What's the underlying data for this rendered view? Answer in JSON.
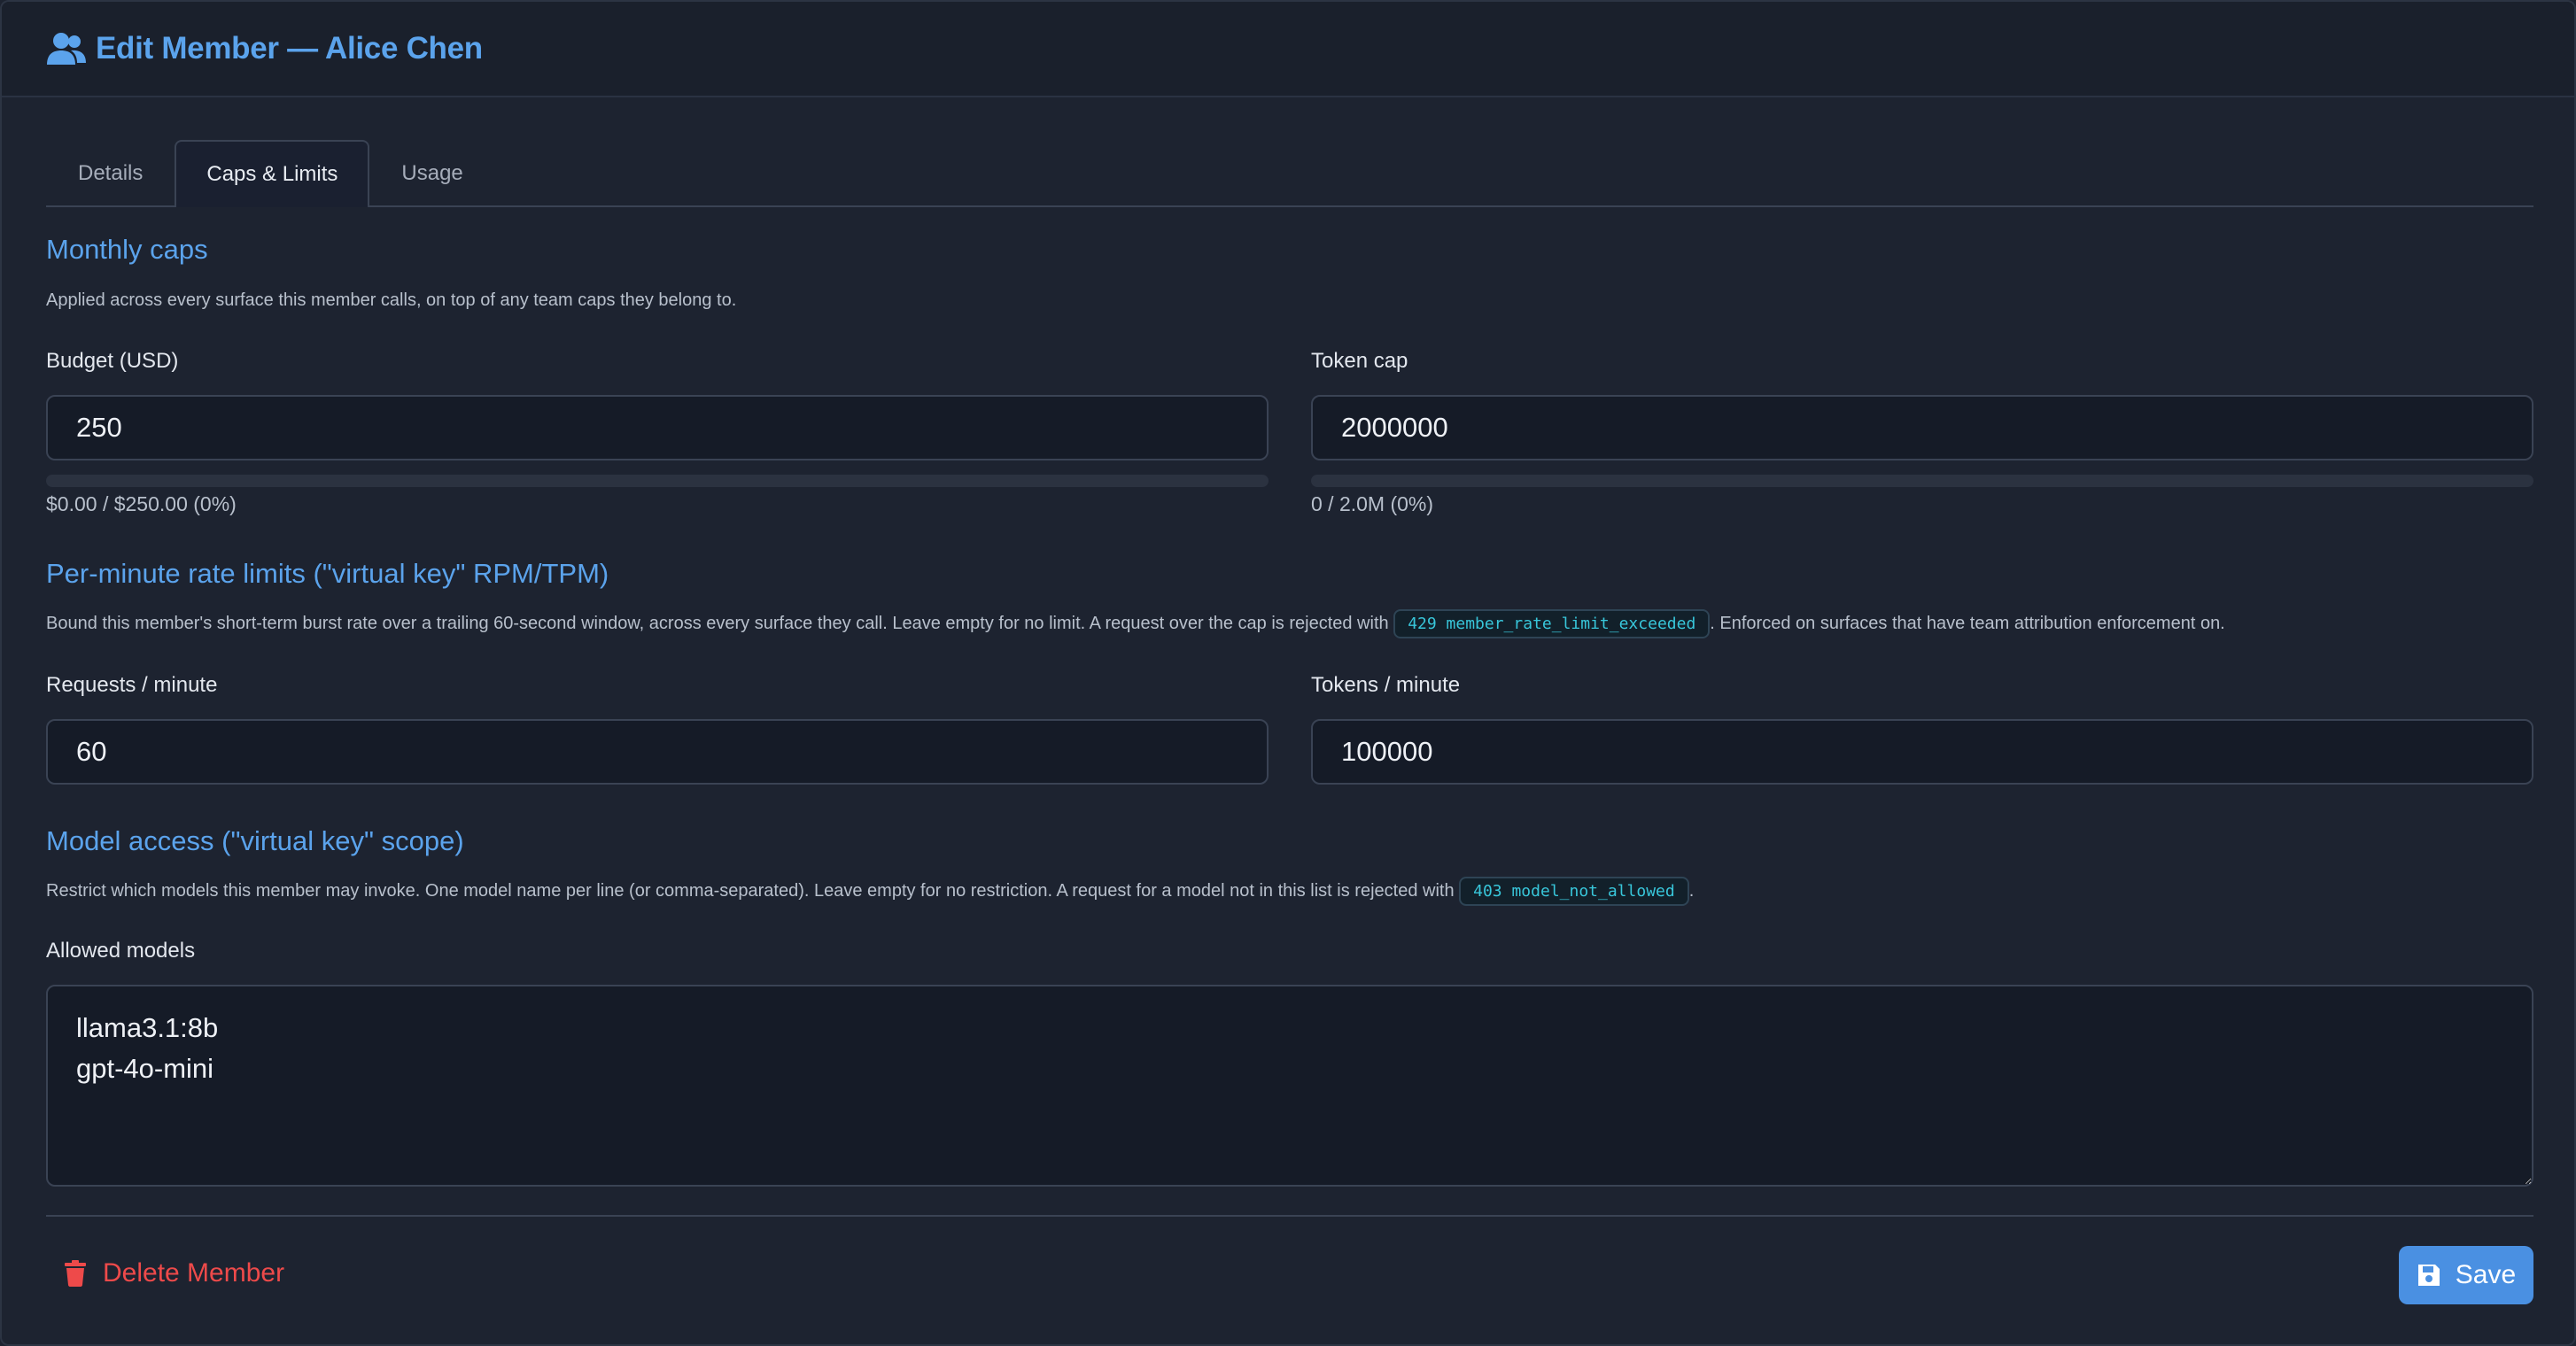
{
  "modal": {
    "title": "Edit Member — Alice Chen"
  },
  "tabs": [
    {
      "label": "Details",
      "active": false
    },
    {
      "label": "Caps & Limits",
      "active": true
    },
    {
      "label": "Usage",
      "active": false
    }
  ],
  "monthly_caps": {
    "title": "Monthly caps",
    "description": "Applied across every surface this member calls, on top of any team caps they belong to.",
    "budget": {
      "label": "Budget (USD)",
      "value": "250",
      "progress_text": "$0.00 / $250.00 (0%)",
      "progress_fraction": 0
    },
    "token_cap": {
      "label": "Token cap",
      "value": "2000000",
      "progress_text": "0 / 2.0M (0%)",
      "progress_fraction": 0
    }
  },
  "rate_limits": {
    "title": "Per-minute rate limits (\"virtual key\" RPM/TPM)",
    "description_before": "Bound this member's short-term burst rate over a trailing 60-second window, across every surface they call. Leave empty for no limit. A request over the cap is rejected with",
    "code": "429 member_rate_limit_exceeded",
    "description_after": ". Enforced on surfaces that have team attribution enforcement on.",
    "rpm": {
      "label": "Requests / minute",
      "value": "60"
    },
    "tpm": {
      "label": "Tokens / minute",
      "value": "100000"
    }
  },
  "model_access": {
    "title": "Model access (\"virtual key\" scope)",
    "description_before": "Restrict which models this member may invoke. One model name per line (or comma-separated). Leave empty for no restriction. A request for a model not in this list is rejected with",
    "code": "403 model_not_allowed",
    "description_after": ".",
    "allowed_label": "Allowed models",
    "allowed_value": "llama3.1:8b\ngpt-4o-mini"
  },
  "footer": {
    "delete_label": "Delete Member",
    "save_label": "Save"
  },
  "colors": {
    "accent": "#5ba3ec",
    "danger": "#ee4a4a",
    "primary_button": "#4a90e2",
    "code": "#38c6da"
  },
  "icons": {
    "header": "users-icon",
    "delete": "trash-icon",
    "save": "floppy-disk-icon"
  }
}
